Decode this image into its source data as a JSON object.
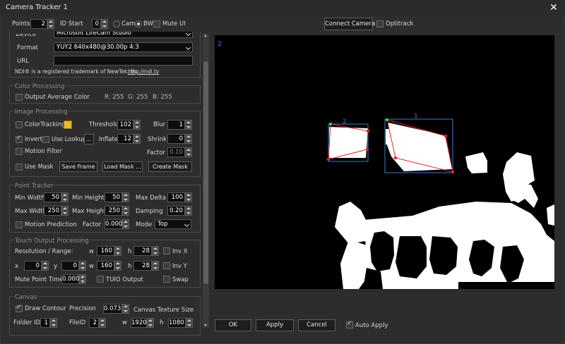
{
  "window": {
    "title": "Camera Tracker 1",
    "close_glyph": "✕"
  },
  "top": {
    "points_label": "Points",
    "points_value": "2",
    "id_start_label": "ID Start",
    "id_start_value": "0",
    "cam_label": "Cam",
    "bw_label": "BW",
    "bw_selected": true,
    "mute_ui_label": "Mute UI",
    "connect_camera_label": "Connect Camera",
    "optitrack_label": "Optitrack"
  },
  "device": {
    "device_label": "Device",
    "device_value": "Microsoft LifeCam Studio",
    "format_label": "Format",
    "format_value": "YUY2 640x480@30.00p 4:3",
    "url_label": "URL",
    "url_value": "",
    "ndi_notice": "NDI® is a registered trademark of NewTek, Inc. -",
    "ndi_link": "http://ndi.tv"
  },
  "color_processing": {
    "title": "Color Processing",
    "output_avg_label": "Output Average Color",
    "r_label": "R: 255",
    "g_label": "G: 255",
    "b_label": "B: 255"
  },
  "image_processing": {
    "title": "Image Processing",
    "color_tracking_label": "ColorTracking",
    "threshold_label": "Threshold",
    "threshold_value": "102",
    "blur_label": "Blur",
    "blur_value": "1",
    "invert_label": "Invert",
    "use_lookup_label": "Use Lookup",
    "lookup_btn": "...",
    "inflate_label": "Inflate",
    "inflate_value": "12",
    "shrink_label": "Shrink",
    "shrink_value": "0",
    "motion_filter_label": "Motion Filter",
    "factor_label": "Factor",
    "factor_value": "0.10",
    "use_mask_label": "Use Mask",
    "save_frame_label": "Save Frame",
    "load_mask_label": "Load Mask ...",
    "create_mask_label": "Create Mask"
  },
  "point_tracker": {
    "title": "Point Tracker",
    "min_width_label": "Min Width",
    "min_width_value": "50",
    "min_height_label": "Min Height",
    "min_height_value": "50",
    "max_delta_label": "Max Delta",
    "max_delta_value": "100",
    "max_width_label": "Max Width",
    "max_width_value": "250",
    "max_height_label": "Max Height",
    "max_height_value": "250",
    "damping_label": "Damping",
    "damping_value": "0.20",
    "motion_prediction_label": "Motion Prediction",
    "factor_label": "Factor",
    "factor_value": "0.000",
    "mode_label": "Mode",
    "mode_value": "Top"
  },
  "touch_output": {
    "title": "Touch Output Processing",
    "resolution_label": "Resolution / Range:",
    "w_label": "w",
    "w_value": "160",
    "h_label": "h",
    "h_value": "28",
    "inv_x_label": "Inv X",
    "x_label": "x",
    "x_value": "0",
    "y_label": "y",
    "y_value": "0",
    "w2_label": "w",
    "w2_value": "160",
    "h2_label": "h",
    "h2_value": "28",
    "inv_y_label": "Inv Y",
    "mute_point_time_label": "Mute Point Time",
    "mute_point_time_value": "0.000",
    "tuio_output_label": "TUIO Output",
    "swap_label": "Swap"
  },
  "canvas": {
    "title": "Canvas",
    "draw_contour_label": "Draw Contour",
    "precision_label": "Precision",
    "precision_value": "0.073",
    "canvas_texture_size_label": "Canvas Texture Size",
    "folder_id_label": "Folder ID",
    "folder_id_value": "1",
    "file_id_label": "FileID",
    "file_id_value": "2",
    "w_label": "w",
    "w_value": "1920",
    "h_label": "h",
    "h_value": "1080"
  },
  "preview": {
    "count_label": "2",
    "blob1_label": "1",
    "blob2_label": "2"
  },
  "buttons": {
    "ok": "OK",
    "apply": "Apply",
    "cancel": "Cancel",
    "auto_apply": "Auto Apply"
  },
  "colors": {
    "accent_blue": "#3a7bd5",
    "marker_red": "#e0242a",
    "marker_green": "#39d439",
    "swatch_yellow": "#e8b830"
  }
}
